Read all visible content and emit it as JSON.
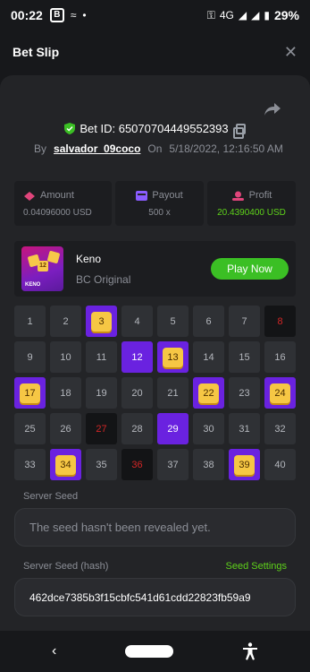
{
  "status_bar": {
    "time": "00:22",
    "network": "4G",
    "battery": "29%"
  },
  "header": {
    "title": "Bet Slip"
  },
  "bet": {
    "id_text": "Bet ID: 65070704449552393",
    "by_label": "By",
    "user": "salvador_09coco",
    "on_label": "On",
    "date": "5/18/2022, 12:16:50 AM"
  },
  "stats": {
    "amount_label": "Amount",
    "amount_value": "0.04096000 USD",
    "payout_label": "Payout",
    "payout_value": "500 x",
    "profit_label": "Profit",
    "profit_value": "20.4390400 USD",
    "colors": {
      "profit": "#5ed21a",
      "payout_icon": "#8a5cff",
      "amount_icon": "#e0457b"
    }
  },
  "game": {
    "name": "Keno",
    "subtitle": "BC Original",
    "play_label": "Play Now",
    "thumb_label": "KENO"
  },
  "keno": {
    "numbers": [
      1,
      2,
      3,
      4,
      5,
      6,
      7,
      8,
      9,
      10,
      11,
      12,
      13,
      14,
      15,
      16,
      17,
      18,
      19,
      20,
      21,
      22,
      23,
      24,
      25,
      26,
      27,
      28,
      29,
      30,
      31,
      32,
      33,
      34,
      35,
      36,
      37,
      38,
      39,
      40
    ],
    "hits": [
      3,
      13,
      17,
      22,
      24,
      34,
      39
    ],
    "picked_no_hit": [
      12,
      29
    ],
    "drawn_miss": [
      8,
      27,
      36
    ]
  },
  "server_seed": {
    "label": "Server Seed",
    "value": "The seed hasn't been revealed yet."
  },
  "server_seed_hash": {
    "label": "Server Seed (hash)",
    "settings_label": "Seed Settings",
    "value": "462dce7385b3f15cbfc541d61cdd22823fb59a9"
  }
}
